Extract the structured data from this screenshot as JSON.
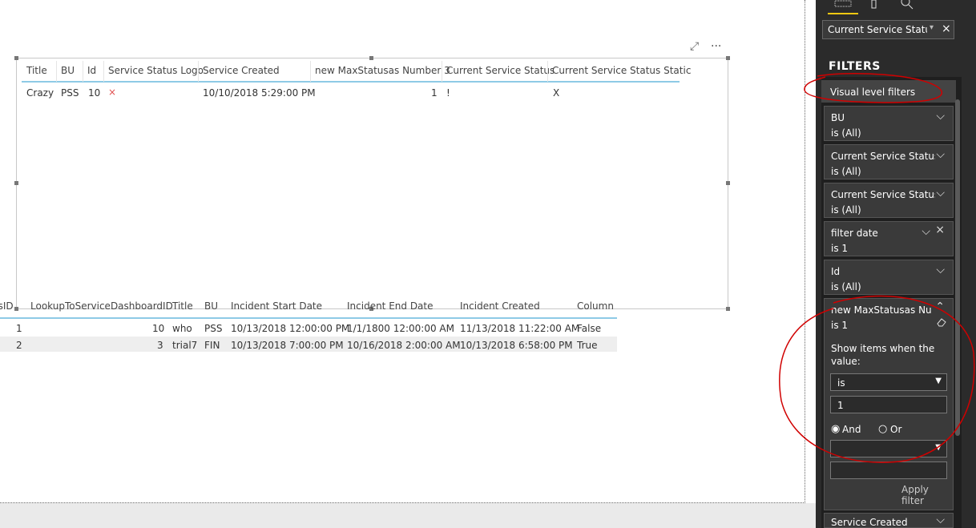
{
  "visual1": {
    "headers": [
      "Title",
      "BU",
      "Id",
      "Service Status Logo",
      "Service Created",
      "new MaxStatusas Number 3",
      "Current Service Status",
      "Current Service Status Static"
    ],
    "row": [
      "Crazy",
      "PSS",
      "10",
      "×",
      "10/10/2018 5:29:00 PM",
      "1",
      "!",
      "X"
    ]
  },
  "visual1_toolbar": {
    "focus_icon": "⤢",
    "more_icon": "···"
  },
  "visual2": {
    "headers": [
      "usID",
      "LookupToServiceDashboardID",
      "Title",
      "BU",
      "Incident Start Date",
      "Incident End Date",
      "Incident Created",
      "Column"
    ],
    "rows": [
      [
        "1",
        "10",
        "who",
        "PSS",
        "10/13/2018 12:00:00 PM",
        "1/1/1800 12:00:00 AM",
        "11/13/2018 11:22:00 AM",
        "False"
      ],
      [
        "2",
        "3",
        "trial7",
        "FIN",
        "10/13/2018 7:00:00 PM",
        "10/16/2018 2:00:00 AM",
        "10/13/2018 6:58:00 PM",
        "True"
      ]
    ]
  },
  "panel": {
    "field_well_value": "Current Service Status S",
    "filters_title": "FILTERS",
    "section_title": "Visual level filters",
    "cards": [
      {
        "name": "BU",
        "value": "is (All)"
      },
      {
        "name": "Current Service Status",
        "value": "is (All)"
      },
      {
        "name": "Current Service Status ...",
        "value": "is (All)"
      },
      {
        "name": "filter date",
        "value": "is 1"
      },
      {
        "name": "Id",
        "value": "is (All)"
      }
    ],
    "expanded": {
      "name": "new MaxStatusas Nu...",
      "value": "is 1",
      "show_items_label": "Show items when the value:",
      "operator": "is",
      "input_value": "1",
      "and_label": "And",
      "or_label": "Or",
      "apply_label": "Apply filter"
    },
    "last_card": {
      "name": "Service Created"
    }
  },
  "colors": {
    "accent": "#f2c811",
    "annotation": "#d00000",
    "panel_bg": "#2b2b2b"
  }
}
